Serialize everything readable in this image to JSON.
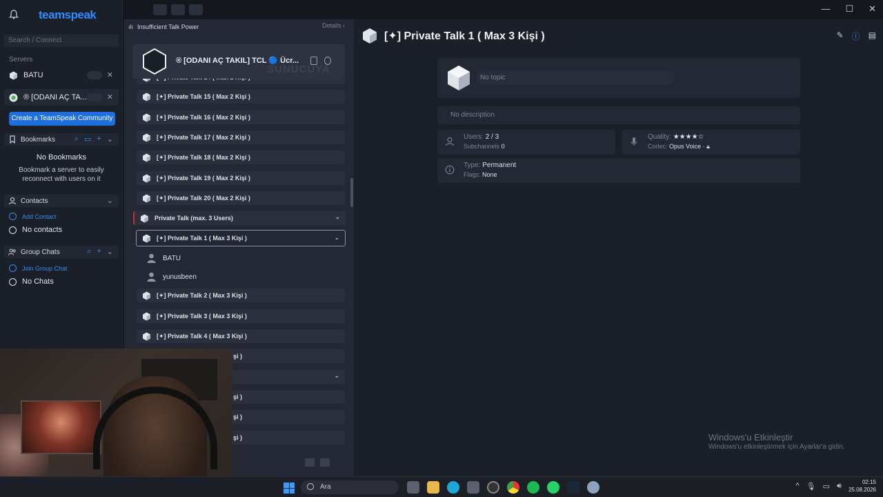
{
  "app": {
    "logo": "teamspeak",
    "search_placeholder": "Search / Connect",
    "window_controls": [
      "—",
      "☐",
      "✕"
    ]
  },
  "sidebar": {
    "servers_label": "Servers",
    "servers": [
      {
        "name": "BATU"
      },
      {
        "name": "® [ODANI AÇ TA..."
      }
    ],
    "create_community": "Create a TeamSpeak Community",
    "bookmarks": {
      "label": "Bookmarks",
      "empty_title": "No Bookmarks",
      "empty_text": "Bookmark a server to easily reconnect with users on it"
    },
    "contacts": {
      "label": "Contacts",
      "add": "Add Contact",
      "empty": "No contacts"
    },
    "group_chats": {
      "label": "Group Chats",
      "join": "Join Group Chat",
      "empty": "No Chats"
    }
  },
  "tree": {
    "status": "Insufficient Talk Power",
    "details": "Details",
    "server_name": "® [ODANI AÇ TAKIL] TCL 🔵 Ücr...",
    "server_watermark": "SUNUCUYA",
    "channels": [
      {
        "name": "[✦] Private Talk 14 ( Max 2 Kişi )"
      },
      {
        "name": "[✦] Private Talk 15 ( Max 2 Kişi )"
      },
      {
        "name": "[✦] Private Talk 16 ( Max 2 Kişi )"
      },
      {
        "name": "[✦] Private Talk 17 ( Max 2 Kişi )"
      },
      {
        "name": "[✦] Private Talk 18 ( Max 2 Kişi )"
      },
      {
        "name": "[✦] Private Talk 19 ( Max 2 Kişi )"
      },
      {
        "name": "[✦] Private Talk 20 ( Max 2 Kişi )"
      }
    ],
    "group_channel": "Private Talk (max. 3 Users)",
    "active_channel": "[✦] Private Talk 1 ( Max 3 Kişi )",
    "users": [
      "BATU",
      "yunusbeen"
    ],
    "channels_after": [
      {
        "name": "[✦] Private Talk 2 ( Max 3 Kişi )"
      },
      {
        "name": "[✦] Private Talk 3 ( Max 3 Kişi )"
      },
      {
        "name": "[✦] Private Talk 4 ( Max 3 Kişi )"
      }
    ],
    "partial_channels": [
      "şi )",
      "şi )",
      "şi )",
      "şi )"
    ]
  },
  "channel_info": {
    "title": "[✦] Private Talk 1 ( Max 3 Kişi )",
    "topic_placeholder": "No topic",
    "description": "No description",
    "users_label": "Users:",
    "users_value": "2 / 3",
    "subchannels_label": "Subchannels",
    "subchannels_value": "0",
    "quality_label": "Quality:",
    "quality_value": "★★★★☆",
    "codec_label": "Codec:",
    "codec_value": "Opus Voice ·",
    "type_label": "Type:",
    "type_value": "Permanent",
    "flags_label": "Flags:",
    "flags_value": "None"
  },
  "os": {
    "activation_title": "Windows'u Etkinleştir",
    "activation_text": "Windows'u etkinleştirmek için Ayarlar'a gidin.",
    "search": "Ara",
    "time": "02:15",
    "date": "25.08.2026"
  },
  "colors": {
    "accent": "#2d8cff",
    "button": "#1e6fde",
    "group_marker": "#c9303d"
  }
}
